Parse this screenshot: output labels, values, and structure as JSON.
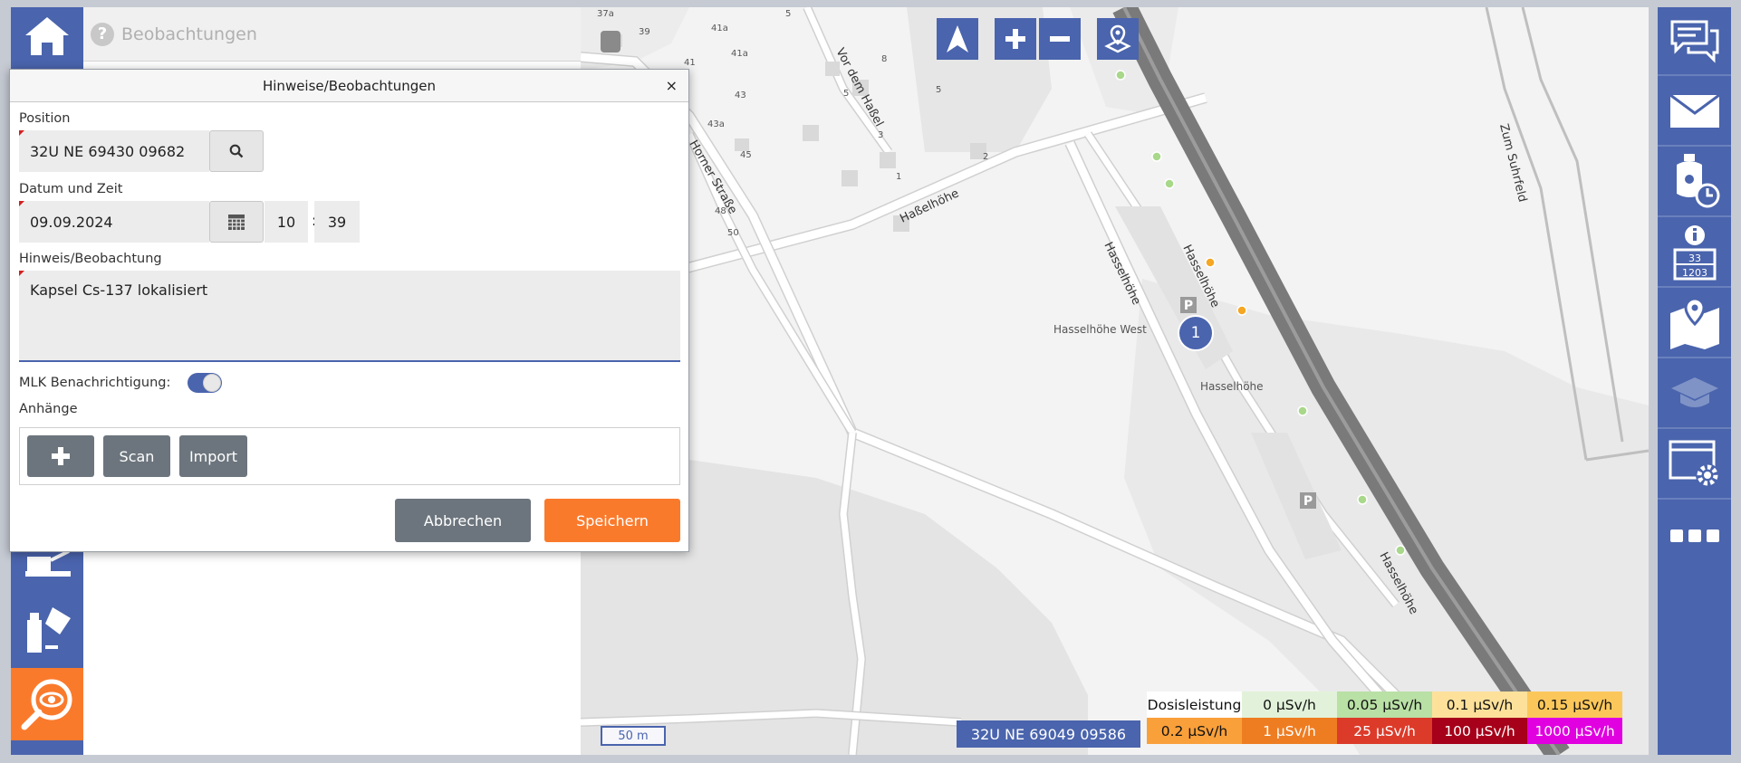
{
  "panel": {
    "title": "Beobachtungen"
  },
  "left_nav": {
    "items": [
      {
        "icon": "home-icon"
      },
      {
        "icon": "measurement-device-icon"
      },
      {
        "icon": "sample-bottles-icon"
      },
      {
        "icon": "observation-search-icon",
        "active": true
      }
    ]
  },
  "map": {
    "coordinate": "32U NE 69049 09586",
    "scale": "50 m",
    "poi_count": "1",
    "labels": {
      "street1": "Vor dem Haßel",
      "street2": "Horner Straße",
      "street3": "Haßelhöhe",
      "street4": "Hasselhöhe",
      "street5": "Hasselhöhe",
      "street6": "Hasselhöhe",
      "street7": "Zum Suhrfeld",
      "place1": "Hasselhöhe West",
      "place2": "Hasselhöhe",
      "house_numbers": [
        "37a",
        "39",
        "41a",
        "41",
        "41a",
        "43",
        "43a",
        "45",
        "48",
        "50",
        "5",
        "8",
        "5",
        "5",
        "3",
        "1",
        "2"
      ]
    },
    "controls": [
      "north-arrow-icon",
      "zoom-in-icon",
      "zoom-out-icon",
      "locate-icon"
    ]
  },
  "legend": {
    "cells": [
      {
        "label": "Dosisleistung",
        "bg": "#ffffff",
        "fg": "#111111"
      },
      {
        "label": "0 µSv/h",
        "bg": "#e2f2da",
        "fg": "#111111"
      },
      {
        "label": "0.05 µSv/h",
        "bg": "#b9e0a5",
        "fg": "#111111"
      },
      {
        "label": "0.1 µSv/h",
        "bg": "#fde19a",
        "fg": "#111111"
      },
      {
        "label": "0.15 µSv/h",
        "bg": "#fcc75a",
        "fg": "#111111"
      },
      {
        "label": "0.2 µSv/h",
        "bg": "#f9a03b",
        "fg": "#111111"
      },
      {
        "label": "1 µSv/h",
        "bg": "#ee7d22",
        "fg": "#ffffff"
      },
      {
        "label": "25 µSv/h",
        "bg": "#dc3b2a",
        "fg": "#ffffff"
      },
      {
        "label": "100 µSv/h",
        "bg": "#a6001a",
        "fg": "#ffffff"
      },
      {
        "label": "1000 µSv/h",
        "bg": "#e000e0",
        "fg": "#ffffff"
      }
    ]
  },
  "right_nav": {
    "items": [
      "chat-icon",
      "mail-icon",
      "device-timer-icon",
      "info-table-icon",
      "map-pin-icon",
      "education-icon",
      "settings-window-icon",
      "more-icon"
    ]
  },
  "dialog": {
    "title": "Hinweise/Beobachtungen",
    "close": "×",
    "position_label": "Position",
    "position_value": "32U NE 69430 09682",
    "datetime_label": "Datum und Zeit",
    "date_value": "09.09.2024",
    "hour_value": "10",
    "time_sep": ":",
    "minute_value": "39",
    "note_label": "Hinweis/Beobachtung",
    "note_value": "Kapsel Cs-137 lokalisiert",
    "mlk_label": "MLK Benachrichtigung:",
    "mlk_enabled": true,
    "attachments_label": "Anhänge",
    "scan_label": "Scan",
    "import_label": "Import",
    "cancel_label": "Abbrechen",
    "save_label": "Speichern",
    "colors": {
      "primary": "#4a64ad",
      "save": "#fa7a2c",
      "cancel": "#6c757d"
    }
  }
}
